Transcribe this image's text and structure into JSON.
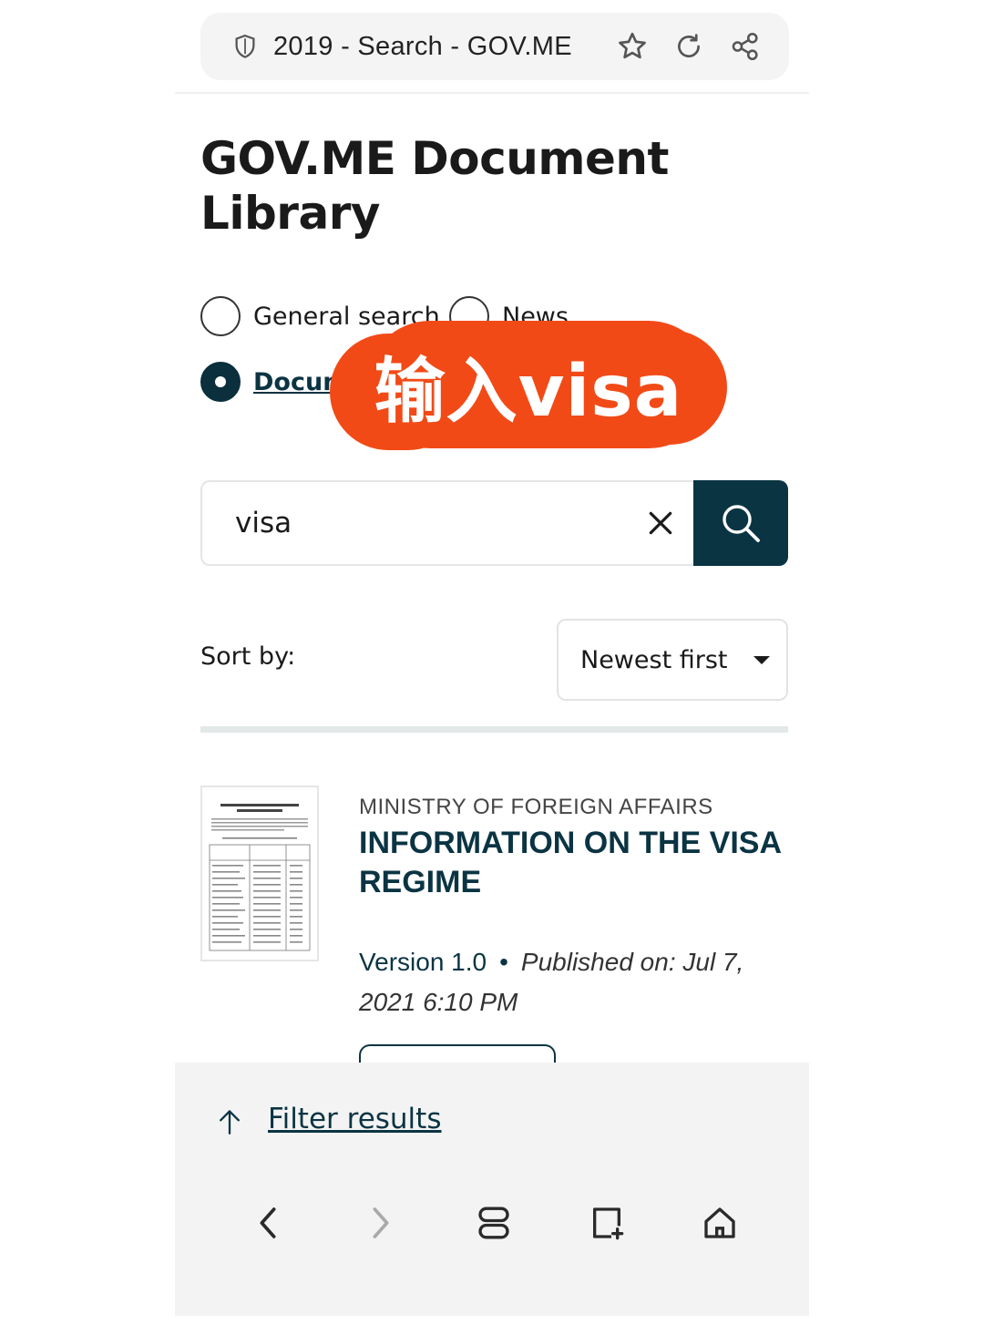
{
  "browser": {
    "tab_title": "2019 - Search - GOV.ME",
    "icons": [
      "shield-icon",
      "star-icon",
      "reload-icon",
      "share-icon"
    ]
  },
  "page": {
    "title": "GOV.ME Document Library"
  },
  "search_scope": {
    "options": [
      {
        "label": "General search",
        "checked": false
      },
      {
        "label": "News",
        "checked": false
      },
      {
        "label": "Docum",
        "checked": true
      }
    ]
  },
  "overlay": {
    "text": "输入visa",
    "color": "#f24a17"
  },
  "search": {
    "value": "visa",
    "clear_icon": "close-icon",
    "submit_icon": "search-icon"
  },
  "sort": {
    "label": "Sort by:",
    "selected": "Newest first"
  },
  "results": [
    {
      "ministry": "MINISTRY OF FOREIGN AFFAIRS",
      "title": "INFORMATION ON THE VISA REGIME",
      "version": "Version 1.0",
      "published": "Published on: Jul 7, 2021 6:10 PM"
    }
  ],
  "filter": {
    "label": "Filter results",
    "icon": "arrow-up-icon"
  },
  "bottom_nav": {
    "icons": [
      "back-icon",
      "forward-icon",
      "tabs-icon",
      "new-tab-icon",
      "home-icon"
    ]
  },
  "colors": {
    "brand": "#0b3443",
    "overlay": "#f24a17"
  }
}
